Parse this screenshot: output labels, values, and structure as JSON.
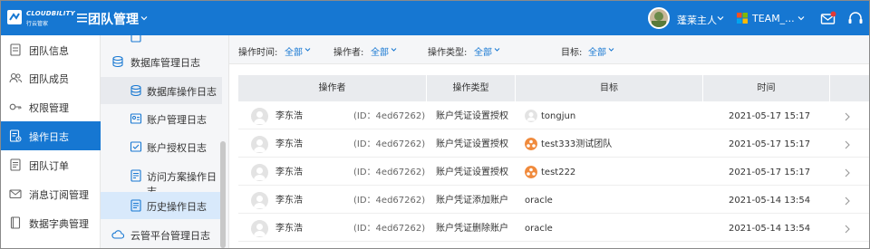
{
  "topbar": {
    "logo_text": "CLOUDBILITY",
    "logo_sub": "行云管家",
    "app_title": "团队管理",
    "user_name": "蓬莱主人",
    "team_name": "TEAM_...",
    "brand_color": "#1677d2",
    "notification_color": "#e53935"
  },
  "sidebar": {
    "items": [
      {
        "label": "团队信息",
        "icon": "document-icon"
      },
      {
        "label": "团队成员",
        "icon": "users-icon"
      },
      {
        "label": "权限管理",
        "icon": "key-icon"
      },
      {
        "label": "操作日志",
        "icon": "log-icon",
        "active": true
      },
      {
        "label": "团队订单",
        "icon": "order-icon"
      },
      {
        "label": "消息订阅管理",
        "icon": "mail-icon"
      },
      {
        "label": "数据字典管理",
        "icon": "book-icon"
      }
    ]
  },
  "subnav": {
    "items": [
      {
        "label": "数据库管理日志",
        "icon": "database-icon",
        "type": "parent"
      },
      {
        "label": "数据库操作日志",
        "icon": "database-icon",
        "type": "child"
      },
      {
        "label": "账户管理日志",
        "icon": "account-icon",
        "type": "child"
      },
      {
        "label": "账户授权日志",
        "icon": "account-auth-icon",
        "type": "child"
      },
      {
        "label": "访问方案操作日志",
        "icon": "access-plan-icon",
        "type": "child"
      },
      {
        "label": "历史操作日志",
        "icon": "history-icon",
        "type": "child",
        "active": true
      },
      {
        "label": "云管平台管理日志",
        "icon": "cloud-icon",
        "type": "parent"
      }
    ]
  },
  "filters": [
    {
      "label": "操作时间:",
      "value": "全部"
    },
    {
      "label": "操作者:",
      "value": "全部"
    },
    {
      "label": "操作类型:",
      "value": "全部"
    },
    {
      "label": "目标:",
      "value": "全部"
    }
  ],
  "table": {
    "columns": [
      "操作者",
      "操作类型",
      "目标",
      "时间"
    ],
    "rows": [
      {
        "operator": "李东浩",
        "id": "(ID：4ed67262)",
        "op_type": "账户凭证设置授权",
        "target": "tongjun",
        "target_icon": "user-icon",
        "time": "2021-05-17 15:17"
      },
      {
        "operator": "李东浩",
        "id": "(ID：4ed67262)",
        "op_type": "账户凭证设置授权",
        "target": "test333测试团队",
        "target_icon": "team-icon",
        "time": "2021-05-17 15:17"
      },
      {
        "operator": "李东浩",
        "id": "(ID：4ed67262)",
        "op_type": "账户凭证设置授权",
        "target": "test222",
        "target_icon": "team-icon",
        "time": "2021-05-17 15:17"
      },
      {
        "operator": "李东浩",
        "id": "(ID：4ed67262)",
        "op_type": "账户凭证添加账户",
        "target": "oracle",
        "target_icon": "",
        "time": "2021-05-14 13:54"
      },
      {
        "operator": "李东浩",
        "id": "(ID：4ed67262)",
        "op_type": "账户凭证删除账户",
        "target": "oracle",
        "target_icon": "",
        "time": "2021-05-14 13:54"
      }
    ]
  }
}
